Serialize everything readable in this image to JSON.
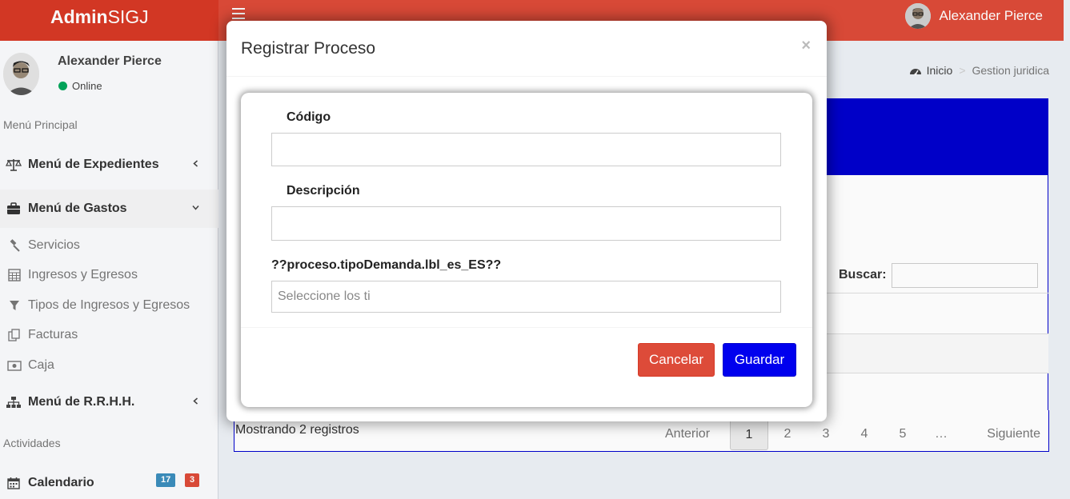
{
  "header": {
    "logo_bold": "Admin",
    "logo_light": "SIGJ",
    "user_name": "Alexander Pierce"
  },
  "sidebar": {
    "user_name": "Alexander Pierce",
    "status": "Online",
    "section_main": "Menú Principal",
    "section_activities": "Actividades",
    "menu_expedientes": "Menú de Expedientes",
    "menu_gastos": "Menú de Gastos",
    "submenu": [
      {
        "label": "Servicios",
        "icon": "gavel-icon"
      },
      {
        "label": "Ingresos y Egresos",
        "icon": "calculator-icon"
      },
      {
        "label": "Tipos de Ingresos y Egresos",
        "icon": "filter-icon"
      },
      {
        "label": "Facturas",
        "icon": "copy-icon"
      },
      {
        "label": "Caja",
        "icon": "money-icon"
      }
    ],
    "menu_rrhh": "Menú de R.R.H.H.",
    "calendar": "Calendario",
    "badge_blue": "17",
    "badge_red": "3"
  },
  "breadcrumb": {
    "home": "Inicio",
    "current": "Gestion juridica"
  },
  "table": {
    "search_label": "Buscar:",
    "showing": "Mostrando 2 registros",
    "pager": {
      "prev": "Anterior",
      "pages": [
        "1",
        "2",
        "3",
        "4",
        "5",
        "…"
      ],
      "next": "Siguiente"
    }
  },
  "modal": {
    "title": "Registrar Proceso",
    "close": "×",
    "codigo_label": "Código",
    "descripcion_label": "Descripción",
    "tipo_label": "??proceso.tipoDemanda.lbl_es_ES??",
    "tipo_placeholder": "Seleccione los ti",
    "cancel": "Cancelar",
    "save": "Guardar"
  },
  "colors": {
    "header_red": "#dd4b39",
    "primary_blue": "#0000ee",
    "online_green": "#00a65a"
  }
}
